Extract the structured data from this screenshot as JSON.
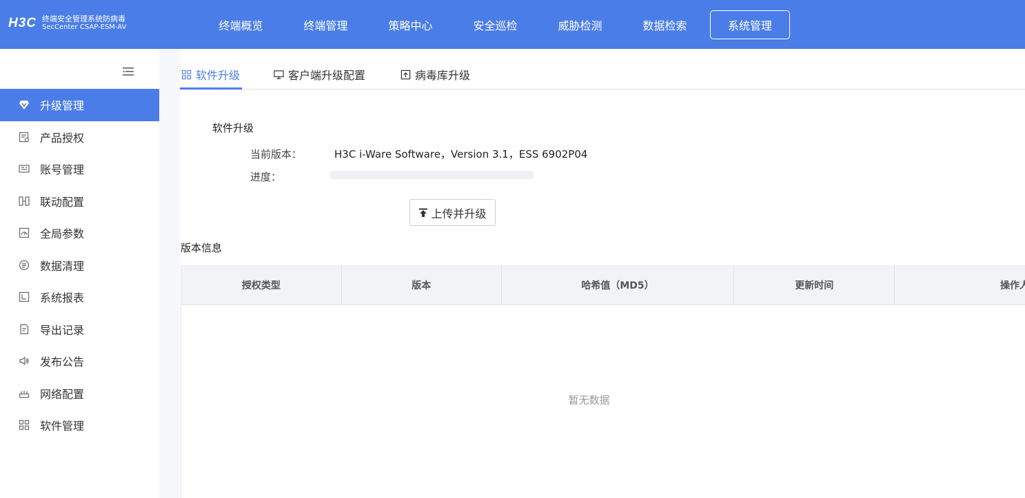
{
  "header": {
    "logo": "H3C",
    "product_name": "终端安全管理系统防病毒",
    "product_sub": "SecCenter CSAP-ESM-AV",
    "nav": [
      {
        "label": "终端概览",
        "active": false
      },
      {
        "label": "终端管理",
        "active": false
      },
      {
        "label": "策略中心",
        "active": false
      },
      {
        "label": "安全巡检",
        "active": false
      },
      {
        "label": "威胁检测",
        "active": false
      },
      {
        "label": "数据检索",
        "active": false
      },
      {
        "label": "系统管理",
        "active": true
      }
    ]
  },
  "sidebar": {
    "items": [
      {
        "label": "升级管理",
        "icon": "diamond-icon",
        "active": true
      },
      {
        "label": "产品授权",
        "icon": "license-icon",
        "active": false
      },
      {
        "label": "账号管理",
        "icon": "id-card-icon",
        "active": false
      },
      {
        "label": "联动配置",
        "icon": "link-icon",
        "active": false
      },
      {
        "label": "全局参数",
        "icon": "gauge-icon",
        "active": false
      },
      {
        "label": "数据清理",
        "icon": "clean-icon",
        "active": false
      },
      {
        "label": "系统报表",
        "icon": "report-icon",
        "active": false
      },
      {
        "label": "导出记录",
        "icon": "export-icon",
        "active": false
      },
      {
        "label": "发布公告",
        "icon": "speaker-icon",
        "active": false
      },
      {
        "label": "网络配置",
        "icon": "router-icon",
        "active": false
      },
      {
        "label": "软件管理",
        "icon": "grid-icon",
        "active": false
      }
    ]
  },
  "tabs": [
    {
      "label": "软件升级",
      "icon": "grid-icon",
      "active": true
    },
    {
      "label": "客户端升级配置",
      "icon": "monitor-icon",
      "active": false
    },
    {
      "label": "病毒库升级",
      "icon": "upload-box-icon",
      "active": false
    }
  ],
  "software_upgrade": {
    "title": "软件升级",
    "version_label": "当前版本：",
    "version_value": "H3C i-Ware Software，Version 3.1，ESS 6902P04",
    "progress_label": "进度：",
    "upload_button": "上传并升级"
  },
  "version_info": {
    "title": "版本信息",
    "columns": [
      "授权类型",
      "版本",
      "哈希值（MD5）",
      "更新时间",
      "操作人员"
    ],
    "empty_text": "暂无数据"
  }
}
